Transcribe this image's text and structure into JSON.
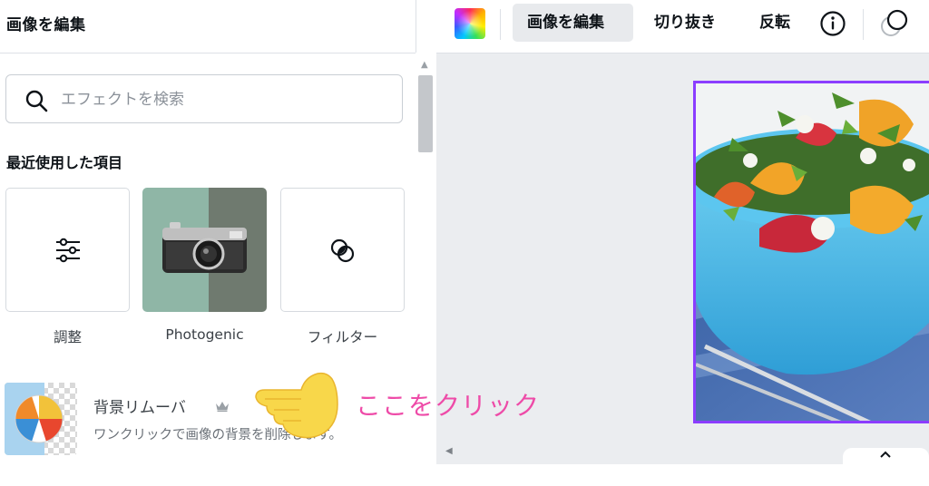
{
  "panel": {
    "title": "画像を編集",
    "search_placeholder": "エフェクトを検索",
    "section_recent": "最近使用した項目",
    "recent_items": [
      {
        "label": "調整",
        "icon": "sliders-icon"
      },
      {
        "label": "Photogenic",
        "icon": "camera-photo-thumbnail"
      },
      {
        "label": "フィルター",
        "icon": "filter-circles-icon"
      }
    ],
    "bg_remover": {
      "name": "背景リムーバ",
      "description": "ワンクリックで画像の背景を削除します。",
      "badge_icon": "crown-icon"
    }
  },
  "toolbar": {
    "color_icon": "color-picker-icon",
    "edit_image": "画像を編集",
    "crop": "切り抜き",
    "flip": "反転",
    "info_icon": "info-icon",
    "transparency_icon": "transparency-icon"
  },
  "canvas": {
    "image_icon": "salad-bowl-photo",
    "selection_color": "#8b3dff"
  },
  "annotation": {
    "text": "ここをクリック",
    "color": "#ee4ba8",
    "pointer_icon": "pointing-hand-icon"
  }
}
